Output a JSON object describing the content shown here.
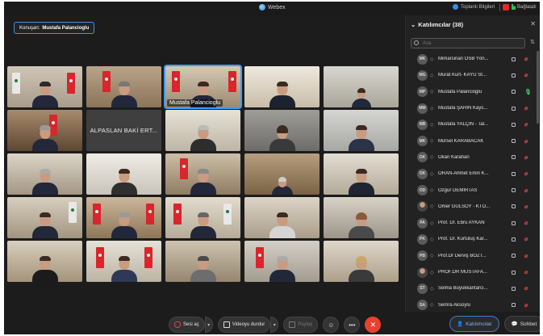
{
  "titlebar": {
    "app_title": "Webex",
    "meeting_info_label": "Toplantı Bilgileri",
    "connection_label": "Bağlandı"
  },
  "speaker": {
    "prefix": "Konuşan:",
    "name": "Mustafa Palancioglu"
  },
  "grid": {
    "active_label": "Mustafa Palancioglu",
    "name_only_tile": "ALPASLAN BAKİ ERT..."
  },
  "controls": {
    "unmute_label": "Sesi aç",
    "stop_video_label": "Videoyu durdur",
    "share_label": "Paylaş",
    "reactions_icon": "smile-icon",
    "more_icon": "ellipsis-icon",
    "end_icon": "close-icon"
  },
  "panel_tabs": {
    "participants_label": "Katılımcılar",
    "chat_label": "Sohbet"
  },
  "participants": {
    "title": "Katılımcılar (38)",
    "search_placeholder": "Ara",
    "items": [
      {
        "initials": "MK",
        "name": "Mimarsinan OSB Yön...",
        "mic": "muted"
      },
      {
        "initials": "MG",
        "name": "Murat Kurt- KAYÜ St...",
        "mic": "muted"
      },
      {
        "initials": "MP",
        "name": "Mustafa Palancioglu",
        "mic": "on"
      },
      {
        "initials": "MM",
        "name": "Mustafa ŞAHİN Kays...",
        "mic": "muted"
      },
      {
        "initials": "MB",
        "name": "Mustafa YALÇIN - Tal...",
        "mic": "muted"
      },
      {
        "initials": "MK",
        "name": "Mürsel KARABACAK",
        "mic": "muted"
      },
      {
        "initials": "OK",
        "name": "Okan Karahan",
        "mic": "muted"
      },
      {
        "initials": "OK",
        "name": "ORAN-Ahmet Emin K...",
        "mic": "muted"
      },
      {
        "initials": "OD",
        "name": "Ozgur DEMIRTAS",
        "mic": "muted"
      },
      {
        "initials": "",
        "name": "Ömer GÜLSOY - KTO...",
        "mic": "muted"
      },
      {
        "initials": "PA",
        "name": "Prof. Dr. Ebru AYKAN",
        "mic": "muted"
      },
      {
        "initials": "PK",
        "name": "Prof. Dr. Kurtuluş Kar...",
        "mic": "muted"
      },
      {
        "initials": "PB",
        "name": "Prof.Dr Derviş BOZT...",
        "mic": "muted"
      },
      {
        "initials": "",
        "name": "PROF.DR MUSTAFA...",
        "mic": "muted"
      },
      {
        "initials": "ST",
        "name": "Selma Büyükkantarcı...",
        "mic": "muted"
      },
      {
        "initials": "SA",
        "name": "Semra Aksoylu",
        "mic": "muted"
      }
    ]
  },
  "colors": {
    "accent": "#3d9bff",
    "end_call": "#e8422f",
    "muted": "#e04545",
    "unmuted": "#43c463"
  }
}
